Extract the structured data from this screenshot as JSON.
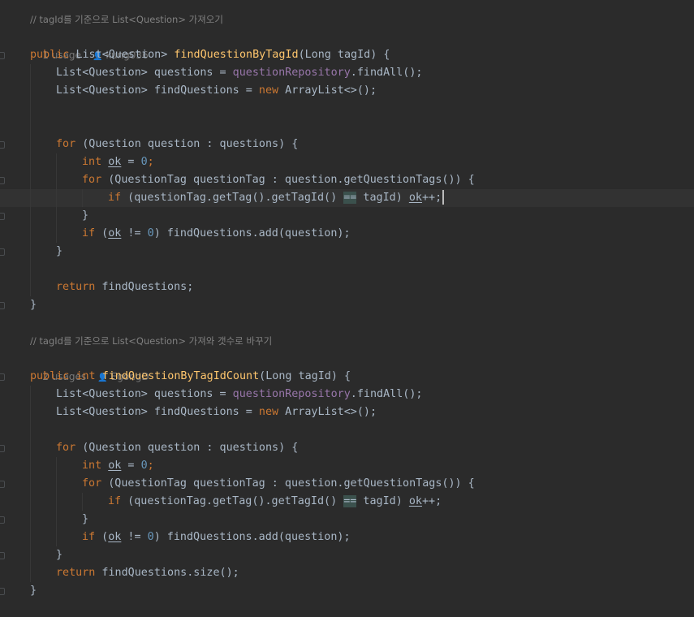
{
  "method1": {
    "comment": "// tagId를 기준으로 List<Question> 가져오기",
    "usages": "1 usage",
    "author": "kung036",
    "sig_mod": "public",
    "sig_type": "List<Question>",
    "sig_name": "findQuestionByTagId",
    "sig_params": "(Long tagId) {",
    "l_questions_type": "List<Question> questions = ",
    "l_questions_repo": "questionRepository",
    "l_questions_rest": ".findAll();",
    "l_find_type": "List<Question> findQuestions = ",
    "l_find_new": "new",
    "l_find_rest": " ArrayList<>();",
    "for_kw": "for",
    "for_rest": " (Question question : questions) {",
    "int_kw": "int",
    "ok": "ok",
    "assign": " = ",
    "zero": "0",
    "semi": ";",
    "inner_for_kw": "for",
    "inner_for_rest": " (QuestionTag questionTag : question.getQuestionTags()) {",
    "if_kw": "if",
    "if_pre": " (questionTag.getTag().getTagId() ",
    "eqeq": "==",
    "if_post": " tagId) ",
    "ok_inc": "ok",
    "inc": "++;",
    "close_brace": "}",
    "if2_kw": "if",
    "if2_open": " (",
    "if2_ok": "ok",
    "if2_neq": " != ",
    "if2_zero": "0",
    "if2_rest": ") findQuestions.add(question);",
    "close_for": "}",
    "return_kw": "return",
    "return_rest": " findQuestions;",
    "close_method": "}"
  },
  "method2": {
    "comment": "// tagId를 기준으로 List<Question> 가져와 갯수로 바꾸기",
    "usages": "2 usages",
    "author": "EgongD",
    "sig_mod": "public",
    "sig_type": "int",
    "sig_name": "findQuestionByTagIdCount",
    "sig_params": "(Long tagId) {",
    "l_questions_type": "List<Question> questions = ",
    "l_questions_repo": "questionRepository",
    "l_questions_rest": ".findAll();",
    "l_find_type": "List<Question> findQuestions = ",
    "l_find_new": "new",
    "l_find_rest": " ArrayList<>();",
    "for_kw": "for",
    "for_rest": " (Question question : questions) {",
    "int_kw": "int",
    "ok": "ok",
    "assign": " = ",
    "zero": "0",
    "semi": ";",
    "inner_for_kw": "for",
    "inner_for_rest": " (QuestionTag questionTag : question.getQuestionTags()) {",
    "if_kw": "if",
    "if_pre": " (questionTag.getTag().getTagId() ",
    "eqeq": "==",
    "if_post": " tagId) ",
    "ok_inc": "ok",
    "inc": "++;",
    "close_brace": "}",
    "if2_kw": "if",
    "if2_open": " (",
    "if2_ok": "ok",
    "if2_neq": " != ",
    "if2_zero": "0",
    "if2_rest": ") findQuestions.add(question);",
    "close_for": "}",
    "return_kw": "return",
    "return_rest": " findQuestions.size();",
    "close_method": "}"
  },
  "colors": {
    "background": "#2b2b2b",
    "keyword": "#cc7832",
    "method_declaration": "#ffc66d",
    "field": "#9876aa",
    "number": "#6897bb",
    "comment": "#808080",
    "default_text": "#a9b7c6"
  },
  "icons": {
    "author": "user-icon",
    "fold": "fold-marker-icon"
  }
}
